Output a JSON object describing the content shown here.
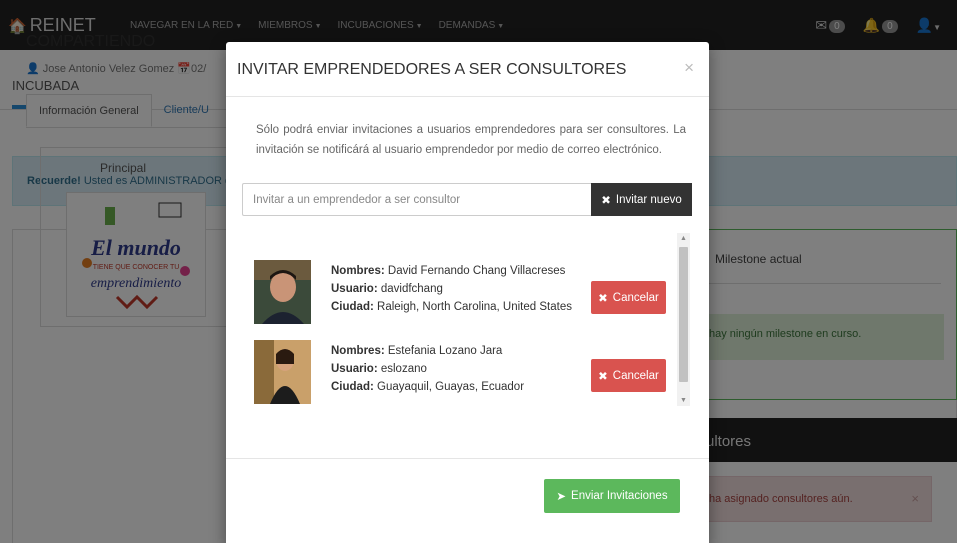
{
  "navbar": {
    "brand": "REINET",
    "links": [
      "NAVEGAR EN LA RED",
      "MIEMBROS",
      "INCUBACIONES",
      "DEMANDAS"
    ],
    "messages_count": "0",
    "notifications_count": "0"
  },
  "subnav": {
    "tab": "INCUBADA"
  },
  "alert": {
    "strong": "Recuerde!",
    "text": " Usted es ADMINISTRADOR d"
  },
  "project": {
    "title": "COMPARTIENDO",
    "owner": "Jose Antonio Velez Gomez",
    "date": "02/",
    "tabs": [
      "Información General",
      "Cliente/U"
    ],
    "principal_label": "Principal",
    "logo_lines": [
      "El mundo",
      "TIENE QUE CONOCER TU",
      "emprendimiento"
    ]
  },
  "milestone": {
    "title": "Milestone actual",
    "empty": "hay ningún milestone en curso."
  },
  "consultants": {
    "title": "ultores",
    "empty": "ha asignado consultores aún."
  },
  "modal": {
    "title": "INVITAR EMPRENDEDORES A SER CONSULTORES",
    "close": "×",
    "description": "Sólo podrá enviar invitaciones a usuarios emprendedores para ser consultores. La invitación se notificárá al usuario emprendedor por medio de correo electrónico.",
    "invite_placeholder": "Invitar a un emprendedor a ser consultor",
    "invite_button": "Invitar nuevo",
    "labels": {
      "name": "Nombres:",
      "user": "Usuario:",
      "city": "Ciudad:"
    },
    "cancel_label": "Cancelar",
    "invitees": [
      {
        "name": " David Fernando Chang Villacreses",
        "user": " davidfchang",
        "city": " Raleigh, North Carolina, United States"
      },
      {
        "name": " Estefania Lozano Jara",
        "user": " eslozano",
        "city": " Guayaquil, Guayas, Ecuador"
      }
    ],
    "send_button": "Enviar Invitaciones"
  },
  "colors": {
    "navbar": "#222222",
    "primary_tab": "#2b8fd9",
    "danger": "#d9534f",
    "success": "#5cb85c",
    "dark_button": "#333333"
  },
  "icons": [
    "home-icon",
    "envelope-icon",
    "bell-icon",
    "user-icon",
    "user-small-icon",
    "calendar-icon",
    "invite-icon",
    "times-icon",
    "send-icon"
  ]
}
